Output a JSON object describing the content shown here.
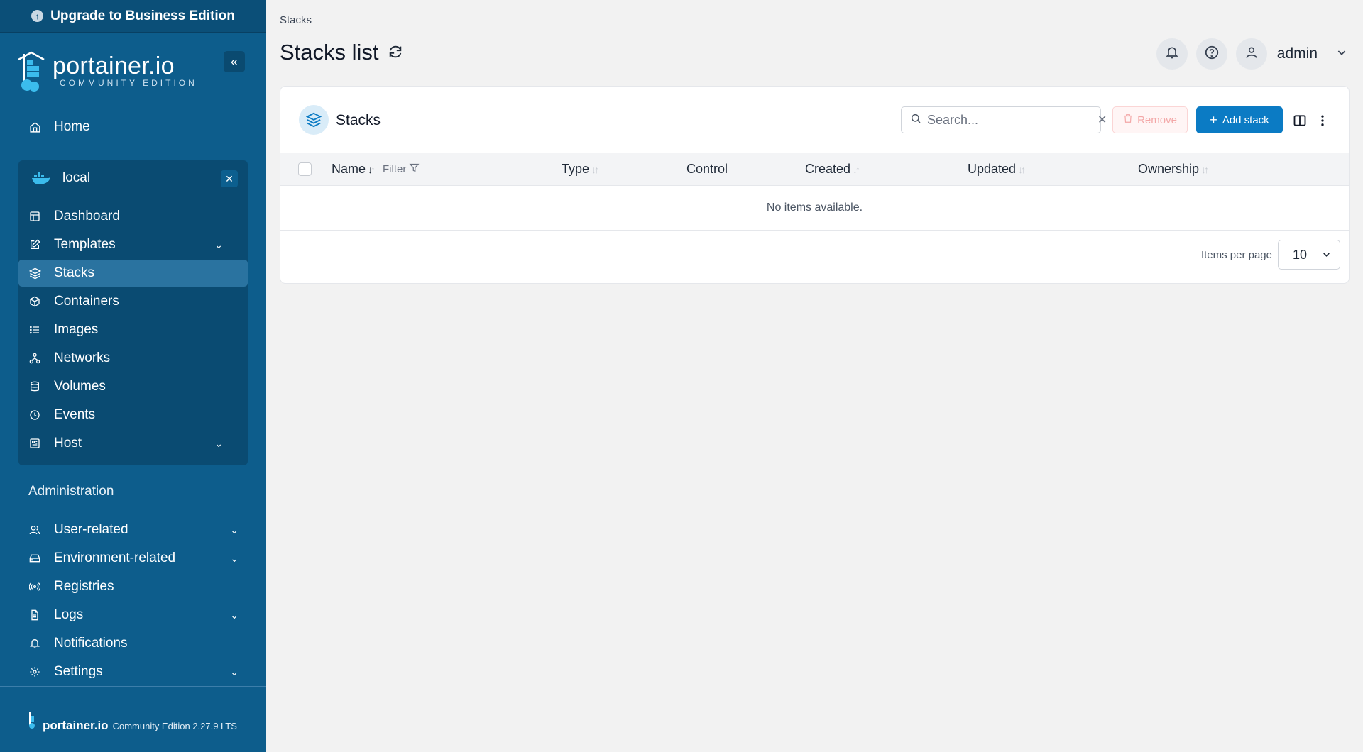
{
  "sidebar": {
    "upgrade_label": "Upgrade to Business Edition",
    "logo_text": "portainer.io",
    "logo_sub": "COMMUNITY EDITION",
    "home_label": "Home",
    "environment": {
      "name": "local",
      "items": [
        {
          "label": "Dashboard",
          "icon": "dashboard-icon",
          "active": false,
          "has_submenu": false
        },
        {
          "label": "Templates",
          "icon": "edit-icon",
          "active": false,
          "has_submenu": true
        },
        {
          "label": "Stacks",
          "icon": "layers-icon",
          "active": true,
          "has_submenu": false
        },
        {
          "label": "Containers",
          "icon": "box-icon",
          "active": false,
          "has_submenu": false
        },
        {
          "label": "Images",
          "icon": "list-icon",
          "active": false,
          "has_submenu": false
        },
        {
          "label": "Networks",
          "icon": "network-icon",
          "active": false,
          "has_submenu": false
        },
        {
          "label": "Volumes",
          "icon": "database-icon",
          "active": false,
          "has_submenu": false
        },
        {
          "label": "Events",
          "icon": "clock-icon",
          "active": false,
          "has_submenu": false
        },
        {
          "label": "Host",
          "icon": "host-icon",
          "active": false,
          "has_submenu": true
        }
      ]
    },
    "admin_title": "Administration",
    "admin_items": [
      {
        "label": "User-related",
        "icon": "users-icon",
        "has_submenu": true
      },
      {
        "label": "Environment-related",
        "icon": "drive-icon",
        "has_submenu": true
      },
      {
        "label": "Registries",
        "icon": "radio-icon",
        "has_submenu": false
      },
      {
        "label": "Logs",
        "icon": "file-icon",
        "has_submenu": true
      },
      {
        "label": "Notifications",
        "icon": "bell-icon",
        "has_submenu": false
      },
      {
        "label": "Settings",
        "icon": "gear-icon",
        "has_submenu": true
      }
    ],
    "footer": {
      "brand": "portainer.io",
      "version": "Community Edition 2.27.9 LTS"
    }
  },
  "header": {
    "breadcrumb": "Stacks",
    "title": "Stacks list",
    "user": "admin"
  },
  "card": {
    "title": "Stacks",
    "search_placeholder": "Search...",
    "remove_label": "Remove",
    "add_label": "Add stack",
    "columns": {
      "name": "Name",
      "filter": "Filter",
      "type": "Type",
      "control": "Control",
      "created": "Created",
      "updated": "Updated",
      "ownership": "Ownership"
    },
    "empty_text": "No items available.",
    "items_per_page_label": "Items per page",
    "items_per_page_value": "10"
  },
  "colors": {
    "sidebar_bg": "#0d5d8c",
    "accent": "#0b7bc4",
    "active_item": "#2a73a0"
  }
}
